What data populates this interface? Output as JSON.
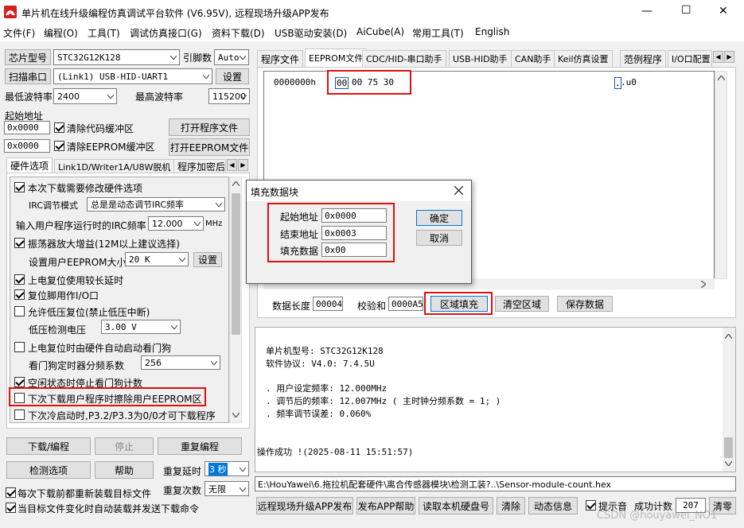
{
  "window": {
    "title": "单片机在线升级编程仿真调试平台软件 (V6.95V), 远程现场升级APP发布",
    "min_glyph": "—",
    "max_glyph": "☐",
    "close_glyph": "✕"
  },
  "menu": [
    "文件(F)",
    "编程(O)",
    "工具(T)",
    "调试仿真接口(G)",
    "资料下载(D)",
    "USB驱动安装(D)",
    "AiCube(A)",
    "常用工具(T)",
    "English"
  ],
  "left": {
    "chip_label": "芯片型号",
    "chip_value": "STC32G12K128",
    "pin_label": "引脚数",
    "pin_value": "Auto",
    "scan_label": "扫描串口",
    "port_value": "(Link1) USB-HID-UART1",
    "settings_label": "设置",
    "min_baud_label": "最低波特率",
    "min_baud_value": "2400",
    "max_baud_label": "最高波特率",
    "max_baud_value": "115200",
    "start_addr_label": "起始地址",
    "addr1": "0x0000",
    "clear_code_label": "清除代码缓冲区",
    "open_prog_label": "打开程序文件",
    "addr2": "0x0000",
    "clear_eeprom_label": "清除EEPROM缓冲区",
    "open_eeprom_label": "打开EEPROM文件",
    "tabs": [
      "硬件选项",
      "Link1D/Writer1A/U8W脱机",
      "程序加密后"
    ],
    "hw": {
      "modify_hw": "本次下载需要修改硬件选项",
      "irc_mode_label": "IRC调节模式",
      "irc_mode_value": "总是是动态调节IRC频率",
      "irc_freq_label": "输入用户程序运行时的IRC频率",
      "irc_freq_value": "12.000",
      "mhz": "MHz",
      "osc_gain": "振荡器放大增益(12M以上建议选择)",
      "eeprom_size_label": "设置用户EEPROM大小",
      "eeprom_size_value": "20  K",
      "eeprom_set": "设置",
      "long_delay": "上电复位使用较长延时",
      "reset_io": "复位脚用作I/O口",
      "lv_reset": "允许低压复位(禁止低压中断)",
      "lv_detect_label": "低压检测电压",
      "lv_detect_value": "3.00 V",
      "wdt_auto": "上电复位时由硬件自动启动看门狗",
      "wdt_div_label": "看门狗定时器分频系数",
      "wdt_div_value": "256",
      "idle_stop_wdt": "空闲状态时停止看门狗计数",
      "erase_eeprom": "下次下载用户程序时擦除用户EEPROM区",
      "cold_boot": "下次冷启动时,P3.2/P3.3为0/0才可下载程序"
    },
    "download_label": "下载/编程",
    "stop_label": "停止",
    "reprogram_label": "重复编程",
    "check_label": "检测选项",
    "help_label": "帮助",
    "repeat_delay_label": "重复延时",
    "repeat_delay_value": "3 秒",
    "repeat_count_label": "重复次数",
    "repeat_count_value": "无限",
    "reload_label": "每次下载前都重新装载目标文件",
    "auto_send_label": "当目标文件变化时自动装载并发送下载命令"
  },
  "right": {
    "tabs": [
      "程序文件",
      "EEPROM文件",
      "CDC/HID-串口助手",
      "USB-HID助手",
      "CAN助手",
      "Keil仿真设置",
      "范例程序",
      "I/O口配置"
    ],
    "hex": {
      "address": "0000000h",
      "sel_byte": "00",
      "rest_bytes": "00 75 30",
      "ascii_sel": ".",
      "ascii_rest": ".u0"
    },
    "data_len_label": "数据长度",
    "data_len_value": "00004",
    "checksum_label": "校验和",
    "checksum_value": "0000A5",
    "fill_label": "区域填充",
    "clear_label": "清空区域",
    "save_label": "保存数据",
    "log": {
      "line1": "单片机型号: STC32G12K128",
      "line2": "软件协议: V4.0: 7.4.5U",
      "line3": ". 用户设定频率: 12.000MHz",
      "line4": ". 调节后的频率: 12.007MHz ( 主时钟分频系数 = 1; )",
      "line5": ". 频率调节误差: 0.060%",
      "line6": "操作成功 !(2025-08-11 15:51:57)"
    },
    "path": "E:\\HouYawei\\6.拖拉机配套硬件\\离合传感器模块\\检测工装?..\\Sensor-module-count.hex",
    "remote_label": "远程现场升级APP发布",
    "publish_help_label": "发布APP帮助",
    "read_disk_label": "读取本机硬盘号",
    "clear_btn": "清除",
    "dynamic_label": "动态信息",
    "beep_label": "提示音",
    "success_label": "成功计数",
    "success_value": "207",
    "clear2_label": "清零"
  },
  "dialog": {
    "title": "填充数据块",
    "start_label": "起始地址",
    "start_value": "0x0000",
    "end_label": "结束地址",
    "end_value": "0x0003",
    "fill_label": "填充数据",
    "fill_value": "0x00",
    "ok_label": "确定",
    "cancel_label": "取消"
  },
  "watermark": "CSDN @houyawei_NO1"
}
